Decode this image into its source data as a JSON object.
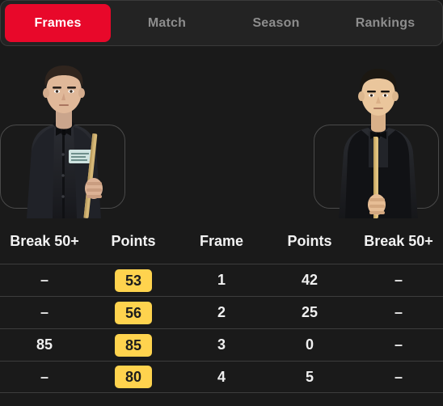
{
  "theme": {
    "background": "#1a1a1a",
    "tabbar_bg": "#232323",
    "tabbar_border": "#3a3a3a",
    "active_tab_bg": "#e8082a",
    "active_tab_text": "#ffffff",
    "inactive_tab_text": "#8d8d8d",
    "row_divider": "#3d3d3d",
    "pill_bg": "#ffd34e",
    "pill_text": "#1c1c1c",
    "text": "#f0f0f0",
    "card_border": "#4a4a4a"
  },
  "tabs": [
    {
      "label": "Frames",
      "active": true
    },
    {
      "label": "Match",
      "active": false
    },
    {
      "label": "Season",
      "active": false
    },
    {
      "label": "Rankings",
      "active": false
    }
  ],
  "players": {
    "left": {
      "side": "left",
      "icon": "player-photo-left"
    },
    "right": {
      "side": "right",
      "icon": "player-photo-right"
    }
  },
  "table": {
    "headers": {
      "break_left": "Break 50+",
      "points_left": "Points",
      "frame": "Frame",
      "points_right": "Points",
      "break_right": "Break 50+"
    },
    "rows": [
      {
        "break_left": "–",
        "points_left": "53",
        "frame": "1",
        "points_right": "42",
        "break_right": "–",
        "points_left_highlight": true
      },
      {
        "break_left": "–",
        "points_left": "56",
        "frame": "2",
        "points_right": "25",
        "break_right": "–",
        "points_left_highlight": true
      },
      {
        "break_left": "85",
        "points_left": "85",
        "frame": "3",
        "points_right": "0",
        "break_right": "–",
        "points_left_highlight": true
      },
      {
        "break_left": "–",
        "points_left": "80",
        "frame": "4",
        "points_right": "5",
        "break_right": "–",
        "points_left_highlight": true
      }
    ]
  }
}
